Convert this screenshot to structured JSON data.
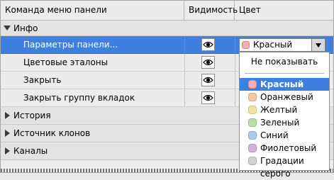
{
  "header": {
    "col_command": "Команда меню панели",
    "col_visibility": "Видимость",
    "col_color": "Цвет"
  },
  "groups": {
    "info": "Инфо",
    "history": "История",
    "clone_source": "Источник клонов",
    "channels": "Каналы"
  },
  "items": [
    {
      "label": "Параметры панели...",
      "selected": true
    },
    {
      "label": "Цветовые эталоны",
      "selected": false
    },
    {
      "label": "Закрыть",
      "selected": false
    },
    {
      "label": "Закрыть группу вкладок",
      "selected": false
    }
  ],
  "dropdown": {
    "value": "Красный",
    "swatch": "#f4aeb4"
  },
  "menu": {
    "top_option": "Не показывать",
    "options": [
      {
        "label": "Красный",
        "color": "#f4aeb4",
        "selected": true
      },
      {
        "label": "Оранжевый",
        "color": "#f5c9a0",
        "selected": false
      },
      {
        "label": "Желтый",
        "color": "#f0e3a5",
        "selected": false
      },
      {
        "label": "Зеленый",
        "color": "#b8dfaa",
        "selected": false
      },
      {
        "label": "Синий",
        "color": "#a9cde8",
        "selected": false
      },
      {
        "label": "Фиолетовый",
        "color": "#d0b1e0",
        "selected": false
      },
      {
        "label": "Градации серого",
        "color": "#d2d2d2",
        "selected": false
      }
    ]
  },
  "colors": {
    "selection": "#3d80df"
  }
}
